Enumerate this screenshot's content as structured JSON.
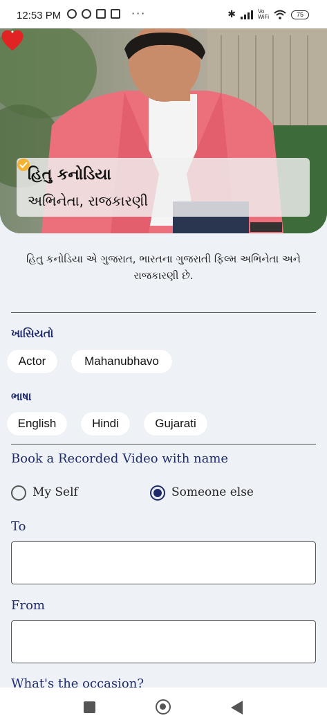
{
  "status_bar": {
    "time": "12:53 PM",
    "battery": "75",
    "vowifi": "Vo WiFi"
  },
  "celebrity": {
    "name": "હિતુ કનોડિયા",
    "role": "અભિનેતા, રાજકારણી",
    "bio": "હિતુ કનોડિયા એ ગુજરાત, ભારતના ગુજરાતી ફિલ્મ અભિનેતા અને રાજકારણી છે.",
    "favorited": true
  },
  "traits": {
    "label": "ખાસિયતો",
    "chips": [
      "Actor",
      "Mahanubhavo"
    ]
  },
  "languages": {
    "label": "ભાષા",
    "chips": [
      "English",
      "Hindi",
      "Gujarati"
    ]
  },
  "booking": {
    "title": "Book a Recorded Video with name",
    "options": [
      {
        "label": "My Self",
        "selected": false
      },
      {
        "label": "Someone else",
        "selected": true
      }
    ],
    "to_label": "To",
    "to_value": "",
    "from_label": "From",
    "from_value": "",
    "occasion_label": "What's the occasion?"
  },
  "colors": {
    "accent": "#1f2a6b",
    "heart": "#e02424",
    "verified": "#f2b233",
    "background": "#eef2f7"
  }
}
